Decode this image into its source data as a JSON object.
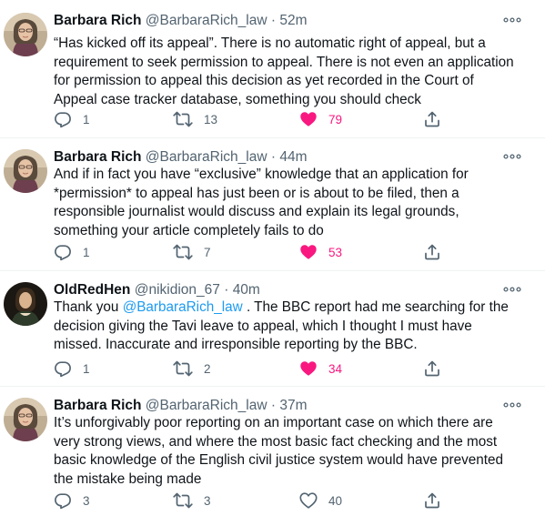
{
  "colors": {
    "accent": "#1d9bf0",
    "like": "#f91880",
    "muted": "#536471",
    "text": "#0f1419"
  },
  "tweets": [
    {
      "name": "Barbara Rich",
      "handle": "@BarbaraRich_law",
      "dot": "·",
      "time": "52m",
      "avatar_icon": "woman-portrait-avatar",
      "text": "“Has kicked off its appeal”.  There is no automatic right of appeal, but a requirement to seek permission to appeal.  There is not even an application for permission to appeal this decision as yet recorded in the Court of Appeal case tracker database, something you should check",
      "replies": "1",
      "retweets": "13",
      "likes": "79",
      "liked": true
    },
    {
      "name": "Barbara Rich",
      "handle": "@BarbaraRich_law",
      "dot": "·",
      "time": "44m",
      "avatar_icon": "woman-portrait-avatar",
      "text": "And if in fact you have “exclusive” knowledge that an application for *permission* to appeal has just been or is about to be filed, then a responsible journalist would discuss and explain its legal grounds, something your article completely fails to do",
      "replies": "1",
      "retweets": "7",
      "likes": "53",
      "liked": true
    },
    {
      "name": "OldRedHen",
      "handle": "@nikidion_67",
      "dot": "·",
      "time": "40m",
      "avatar_icon": "painted-portrait-avatar",
      "text_before": "Thank you ",
      "mention": "@BarbaraRich_law",
      "text_after": " .  The BBC report had me searching for the decision giving the Tavi leave to appeal, which I thought I must have missed.  Inaccurate and irresponsible reporting by the BBC.",
      "replies": "1",
      "retweets": "2",
      "likes": "34",
      "liked": true
    },
    {
      "name": "Barbara Rich",
      "handle": "@BarbaraRich_law",
      "dot": "·",
      "time": "37m",
      "avatar_icon": "woman-portrait-avatar",
      "text": "It’s unforgivably poor reporting on an important case on which there are very strong views, and where the most basic fact checking and the most basic knowledge of the English civil justice system would have prevented the mistake being made",
      "replies": "3",
      "retweets": "3",
      "likes": "40",
      "liked": false
    }
  ]
}
